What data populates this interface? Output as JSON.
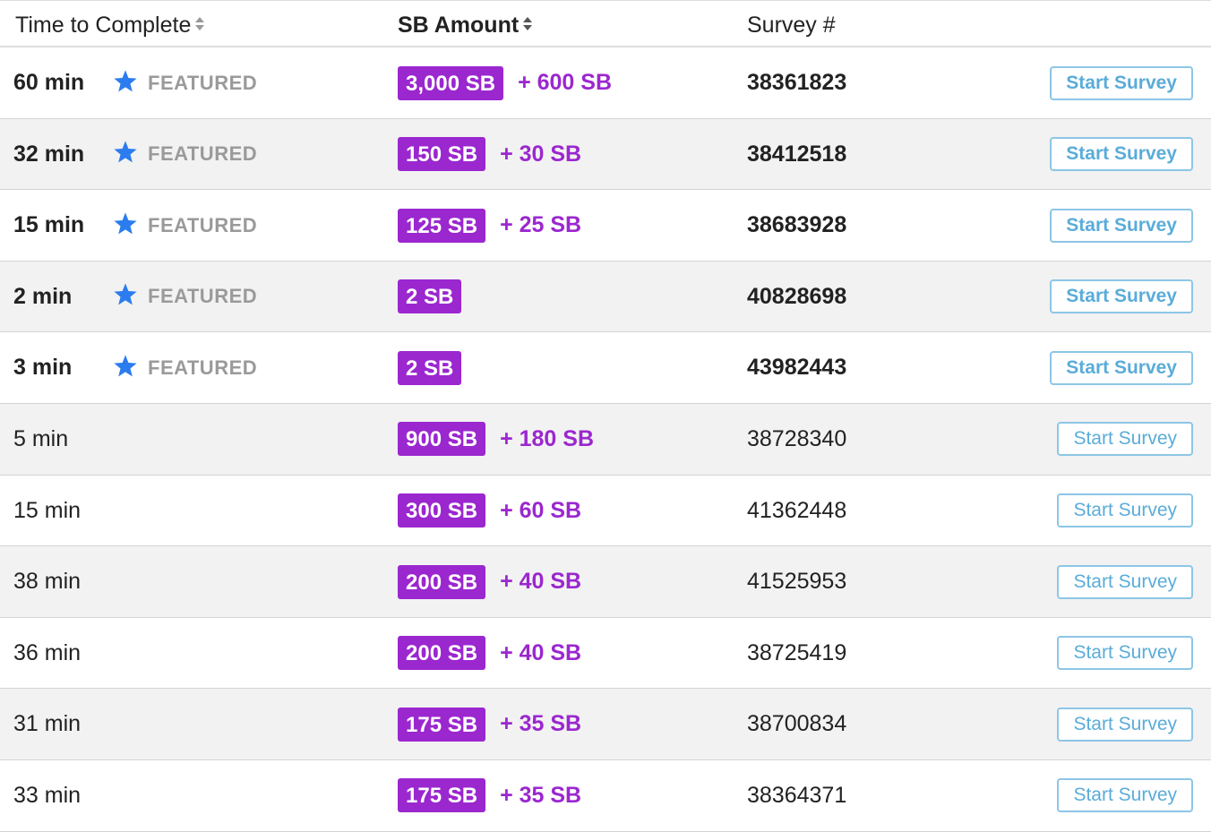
{
  "header": {
    "time_label": "Time to Complete",
    "sb_label": "SB Amount",
    "survey_label": "Survey #"
  },
  "featured_label": "FEATURED",
  "button_label": "Start Survey",
  "colors": {
    "badge": "#9b27cf",
    "star": "#2b7cef",
    "button_border": "#8dc6e6",
    "button_text": "#5aacd9"
  },
  "rows": [
    {
      "time": "60 min",
      "featured": true,
      "sb": "3,000 SB",
      "bonus": "+ 600 SB",
      "survey": "38361823"
    },
    {
      "time": "32 min",
      "featured": true,
      "sb": "150 SB",
      "bonus": "+ 30 SB",
      "survey": "38412518"
    },
    {
      "time": "15 min",
      "featured": true,
      "sb": "125 SB",
      "bonus": "+ 25 SB",
      "survey": "38683928"
    },
    {
      "time": "2 min",
      "featured": true,
      "sb": "2 SB",
      "bonus": "",
      "survey": "40828698"
    },
    {
      "time": "3 min",
      "featured": true,
      "sb": "2 SB",
      "bonus": "",
      "survey": "43982443"
    },
    {
      "time": "5 min",
      "featured": false,
      "sb": "900 SB",
      "bonus": "+ 180 SB",
      "survey": "38728340"
    },
    {
      "time": "15 min",
      "featured": false,
      "sb": "300 SB",
      "bonus": "+ 60 SB",
      "survey": "41362448"
    },
    {
      "time": "38 min",
      "featured": false,
      "sb": "200 SB",
      "bonus": "+ 40 SB",
      "survey": "41525953"
    },
    {
      "time": "36 min",
      "featured": false,
      "sb": "200 SB",
      "bonus": "+ 40 SB",
      "survey": "38725419"
    },
    {
      "time": "31 min",
      "featured": false,
      "sb": "175 SB",
      "bonus": "+ 35 SB",
      "survey": "38700834"
    },
    {
      "time": "33 min",
      "featured": false,
      "sb": "175 SB",
      "bonus": "+ 35 SB",
      "survey": "38364371"
    }
  ]
}
